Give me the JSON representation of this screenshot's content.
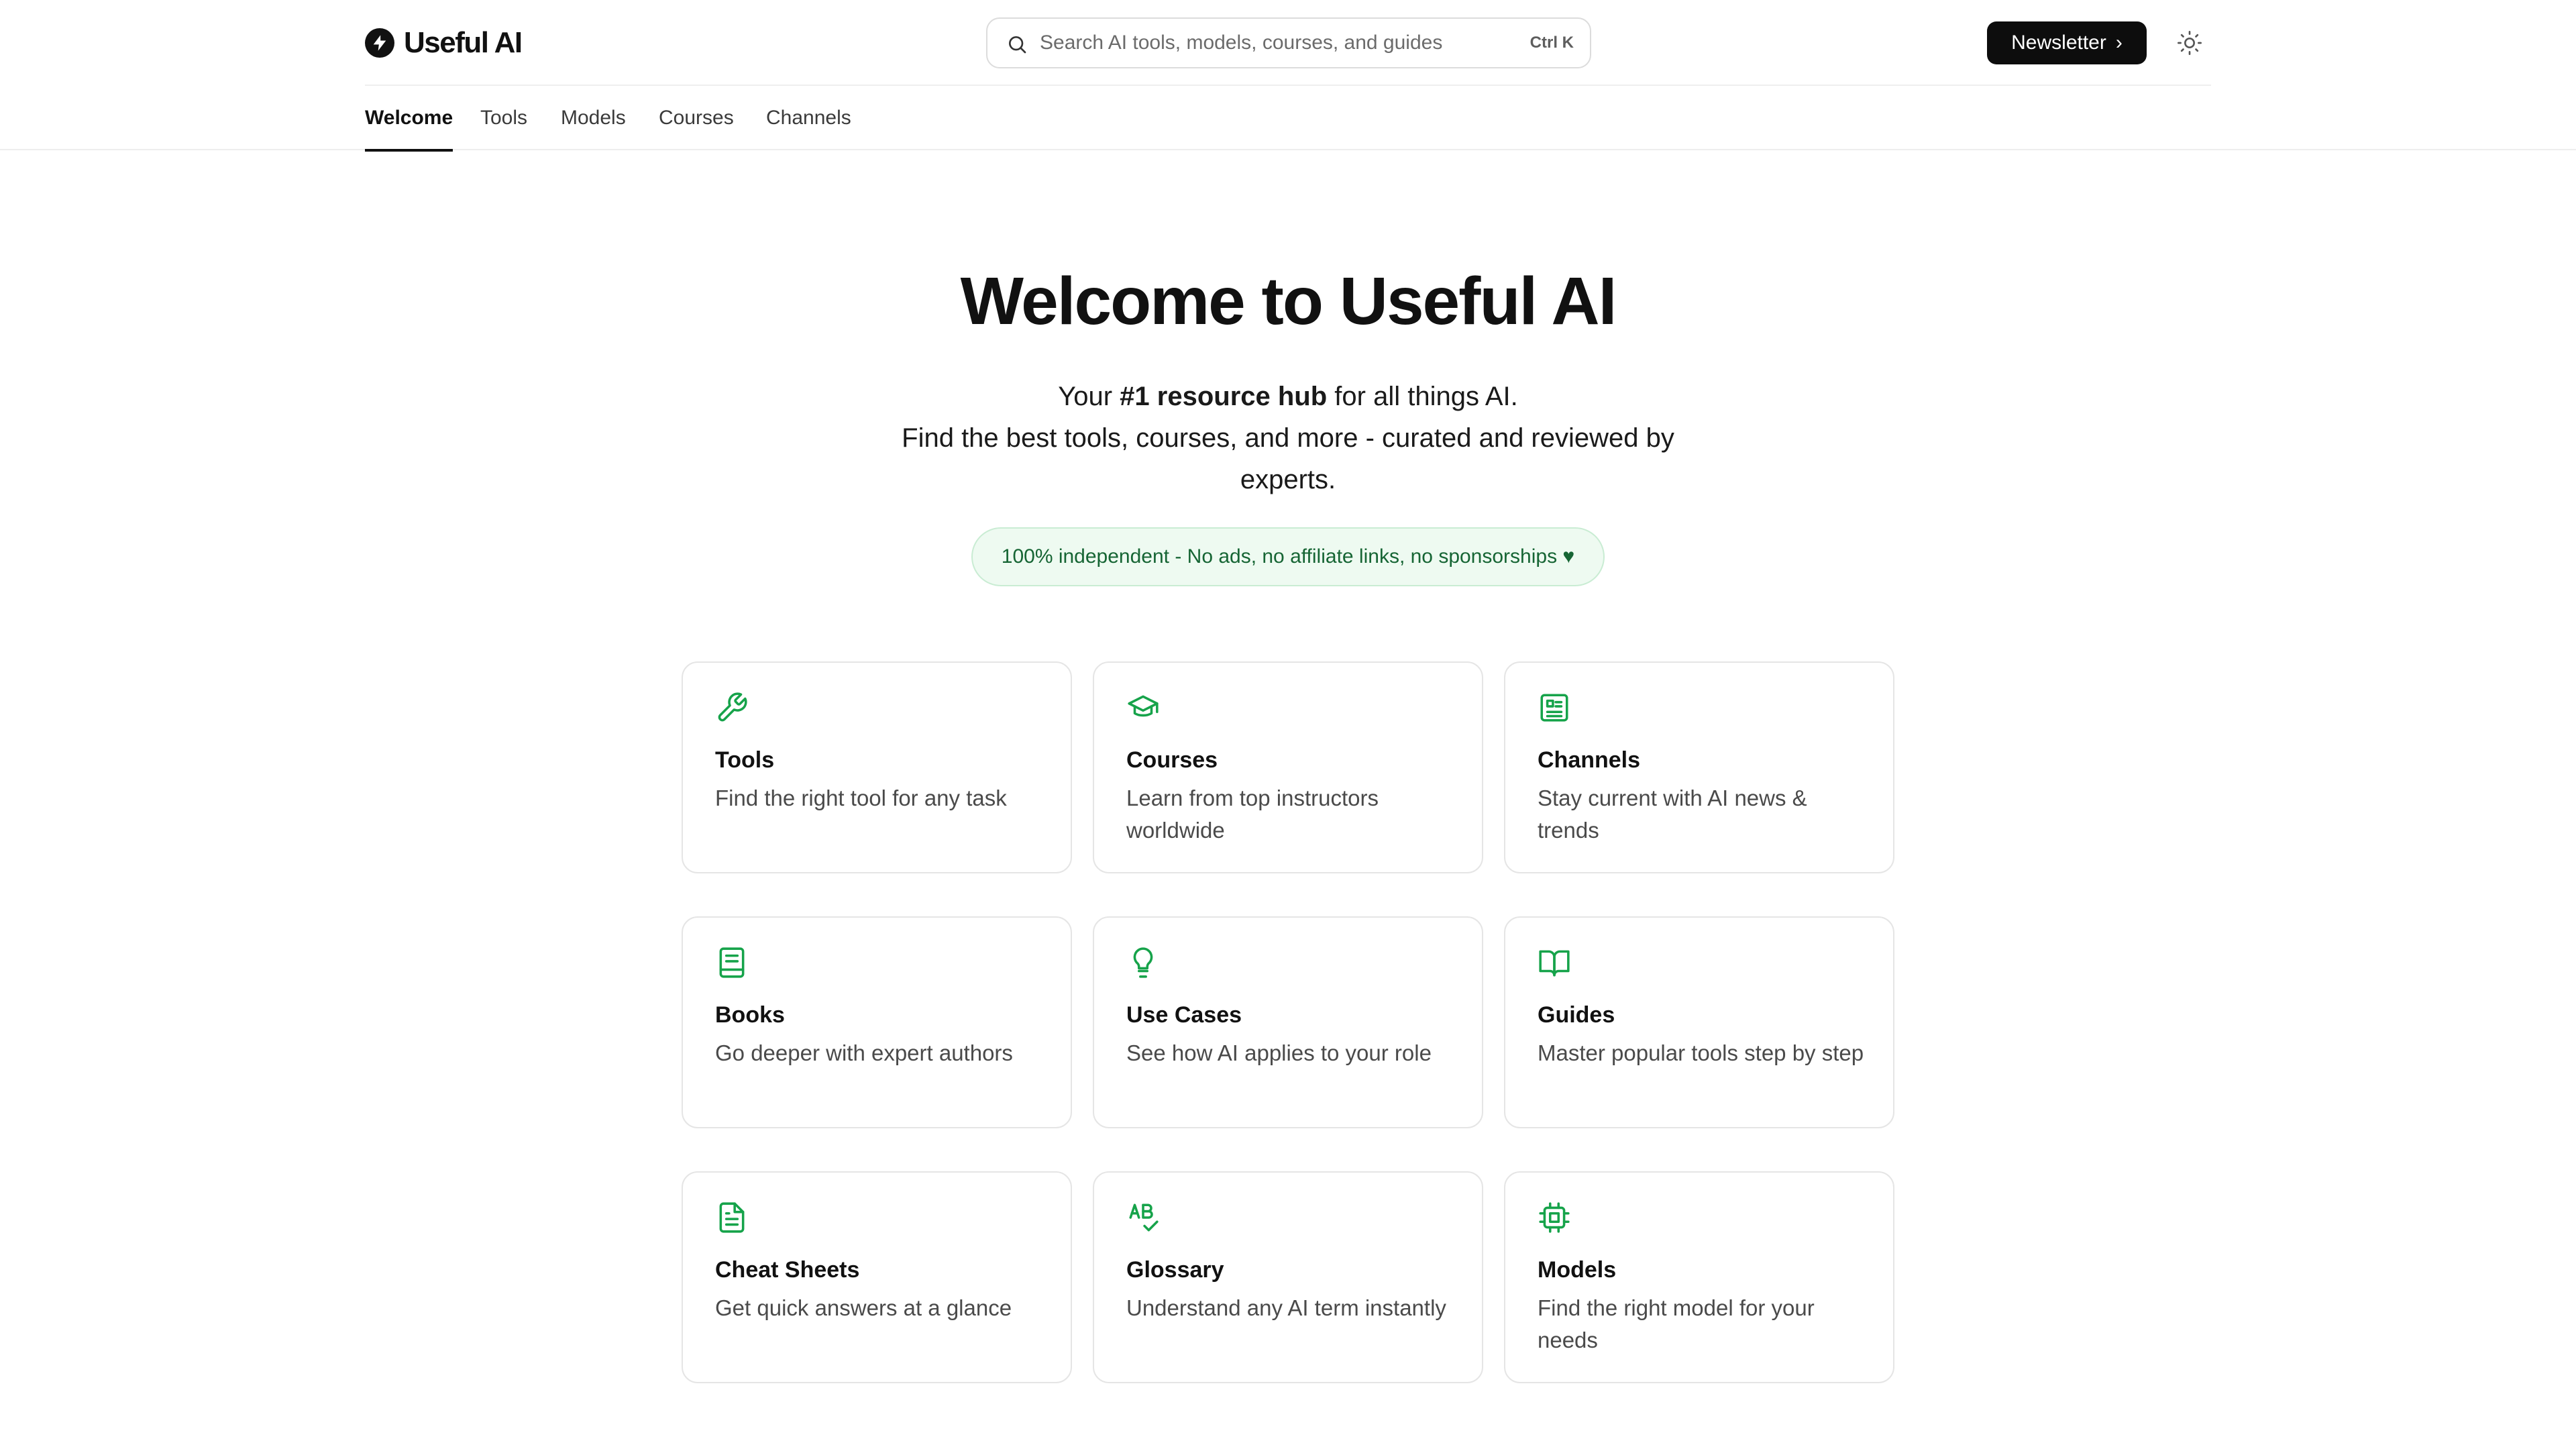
{
  "brand": {
    "name": "Useful AI"
  },
  "search": {
    "placeholder": "Search AI tools, models, courses, and guides",
    "shortcut": "Ctrl K"
  },
  "header": {
    "newsletter_label": "Newsletter",
    "newsletter_chevron": "›"
  },
  "nav": {
    "tabs": [
      {
        "label": "Welcome",
        "active": true
      },
      {
        "label": "Tools"
      },
      {
        "label": "Models"
      },
      {
        "label": "Courses"
      },
      {
        "label": "Channels"
      }
    ]
  },
  "hero": {
    "title": "Welcome to Useful AI",
    "line1_prefix": "Your ",
    "line1_bold": "#1 resource hub",
    "line1_suffix": " for all things AI.",
    "line2": "Find the best tools, courses, and more - curated and reviewed by experts."
  },
  "badge": {
    "text": "100% independent - No ads, no affiliate links, no sponsorships ♥"
  },
  "theme": {
    "accent": "#16a34a",
    "badge_bg": "#eefaf1",
    "badge_text": "#166534"
  },
  "cards": [
    {
      "title": "Tools",
      "desc": "Find the right tool for any task",
      "icon": "wrench-icon"
    },
    {
      "title": "Courses",
      "desc": "Learn from top instructors worldwide",
      "icon": "graduation-cap-icon"
    },
    {
      "title": "Channels",
      "desc": "Stay current with AI news & trends",
      "icon": "newspaper-icon"
    },
    {
      "title": "Books",
      "desc": "Go deeper with expert authors",
      "icon": "book-icon"
    },
    {
      "title": "Use Cases",
      "desc": "See how AI applies to your role",
      "icon": "lightbulb-icon"
    },
    {
      "title": "Guides",
      "desc": "Master popular tools step by step",
      "icon": "book-open-icon"
    },
    {
      "title": "Cheat Sheets",
      "desc": "Get quick answers at a glance",
      "icon": "file-text-icon"
    },
    {
      "title": "Glossary",
      "desc": "Understand any AI term instantly",
      "icon": "spell-check-icon"
    },
    {
      "title": "Models",
      "desc": "Find the right model for your needs",
      "icon": "cpu-icon"
    }
  ]
}
